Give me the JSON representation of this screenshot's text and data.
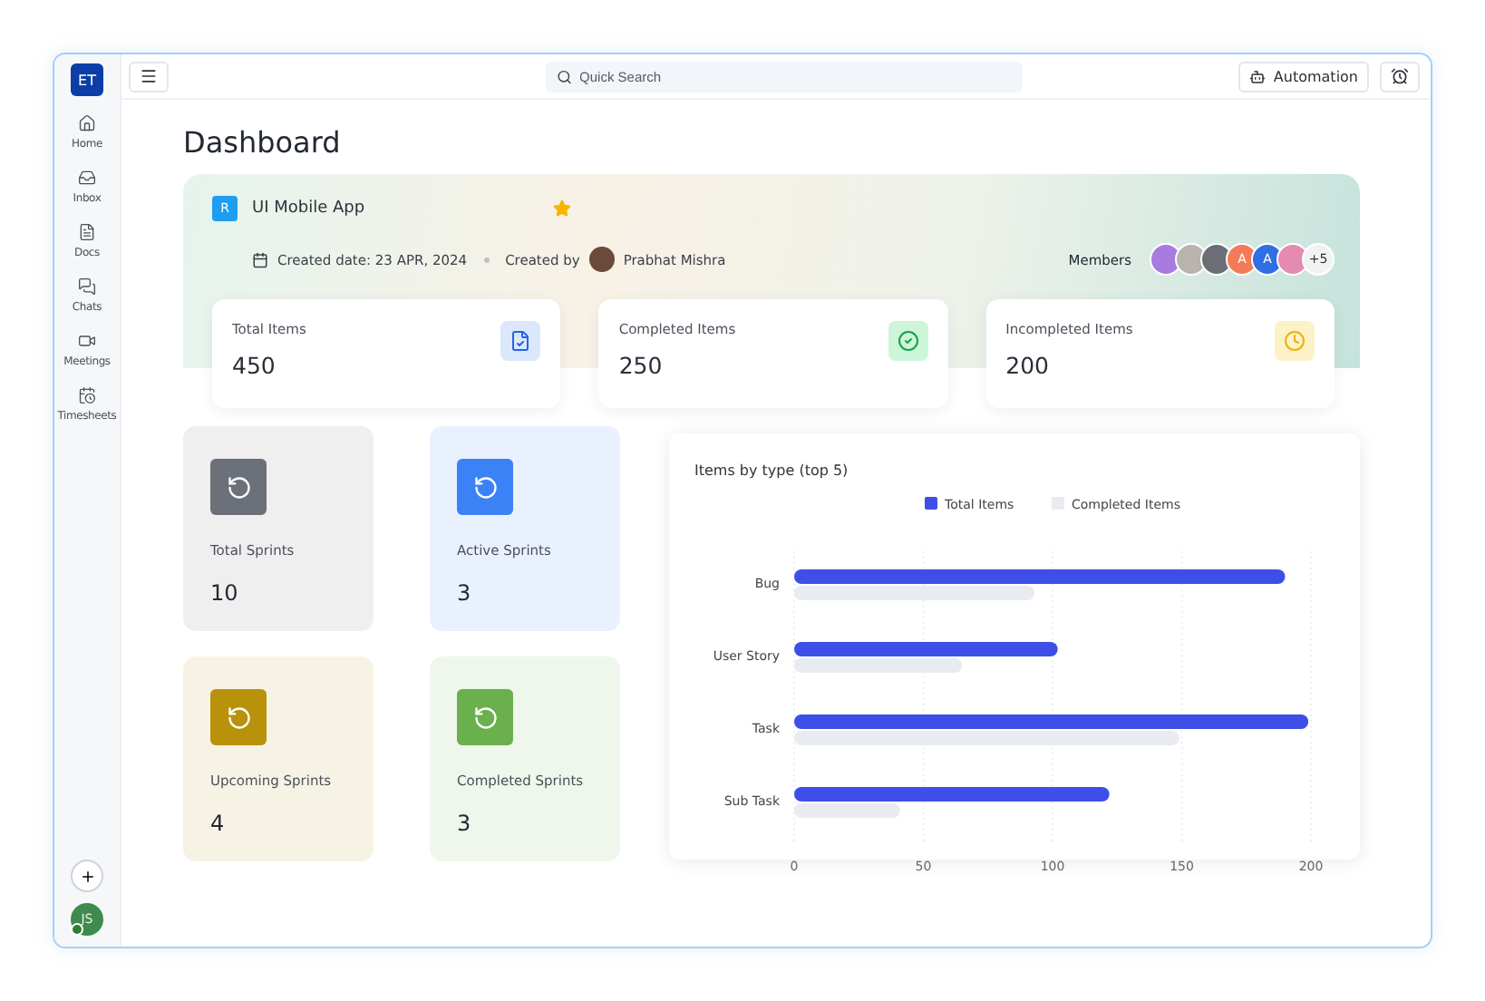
{
  "sidebar": {
    "logo": "ET",
    "items": [
      {
        "label": "Home"
      },
      {
        "label": "Inbox"
      },
      {
        "label": "Docs"
      },
      {
        "label": "Chats"
      },
      {
        "label": "Meetings"
      },
      {
        "label": "Timesheets"
      }
    ],
    "user_initials": "JS"
  },
  "topbar": {
    "search": {
      "placeholder": "Quick Search"
    },
    "automation_button": "Automation"
  },
  "page_title": "Dashboard",
  "project": {
    "badge": "R",
    "name": "UI Mobile App",
    "favorite": true,
    "created_label": "Created date:",
    "created_date": "23 APR, 2024",
    "created_by_label": "Created by",
    "creator": "Prabhat Mishra",
    "members_label": "Members",
    "members": [
      {
        "color": "#a77be0"
      },
      {
        "color": "#b9b3ad"
      },
      {
        "color": "#6b6f75"
      },
      {
        "initials": "A",
        "color": "#f47b5a"
      },
      {
        "initials": "A",
        "color": "#2f6fe4"
      },
      {
        "color": "#e58ab0"
      }
    ],
    "more_members": "+5"
  },
  "stats": [
    {
      "kind": "total",
      "label": "Total Items",
      "value": "450"
    },
    {
      "kind": "completed",
      "label": "Completed Items",
      "value": "250"
    },
    {
      "kind": "incompleted",
      "label": "Incompleted Items",
      "value": "200"
    }
  ],
  "sprints": [
    {
      "label": "Total Sprints",
      "value": "10",
      "color": "#6b7079"
    },
    {
      "label": "Active Sprints",
      "value": "3",
      "color": "#3b82f6"
    },
    {
      "label": "Upcoming Sprints",
      "value": "4",
      "color": "#b8920a"
    },
    {
      "label": "Completed Sprints",
      "value": "3",
      "color": "#6ab04c"
    }
  ],
  "chart": {
    "chart_data": {
      "type": "bar",
      "orientation": "horizontal",
      "title": "Items by type (top 5)",
      "categories": [
        "Bug",
        "User Story",
        "Task",
        "Sub Task"
      ],
      "series": [
        {
          "name": "Total Items",
          "color": "#3d4fe6",
          "values": [
            190,
            102,
            199,
            122
          ]
        },
        {
          "name": "Completed Items",
          "color": "#e8ebf0",
          "values": [
            93,
            65,
            149,
            41
          ]
        }
      ],
      "grid": true,
      "legend": "top",
      "xlim": [
        0,
        200
      ],
      "xticks": [
        {
          "value": 0,
          "label": "0"
        },
        {
          "value": 50,
          "label": "50"
        },
        {
          "value": 100,
          "label": "100"
        },
        {
          "value": 150,
          "label": "150"
        },
        {
          "value": 200,
          "label": "200"
        }
      ]
    }
  }
}
